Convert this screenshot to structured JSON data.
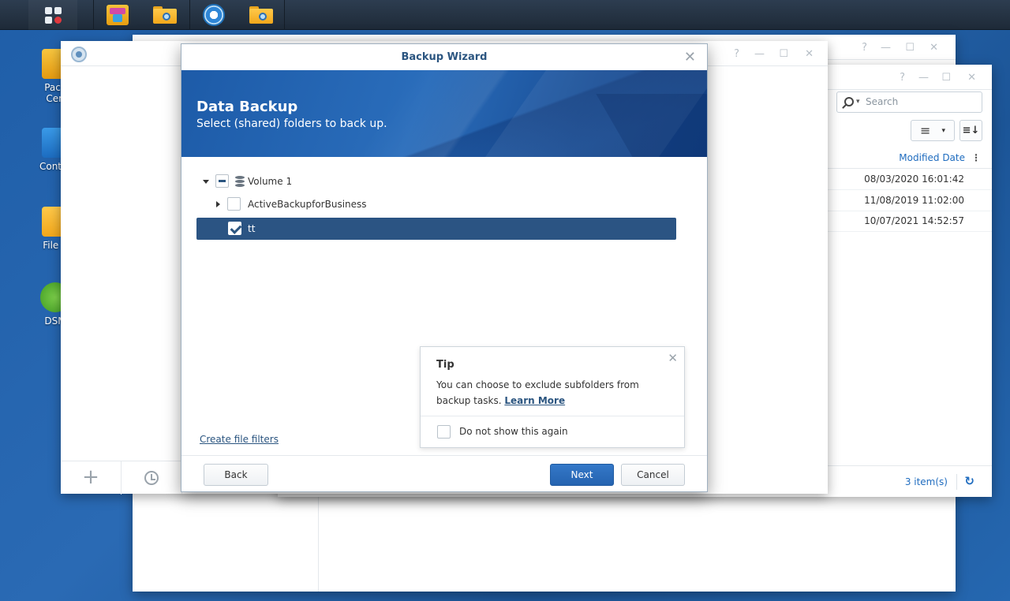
{
  "desktop": {
    "icons": [
      {
        "label": "Pack Cen",
        "line1": "Pack",
        "line2": "Cen"
      },
      {
        "label": "Contro",
        "line1": "Contro",
        "line2": ""
      },
      {
        "label": "File S",
        "line1": "File S",
        "line2": ""
      },
      {
        "label": "DSM",
        "line1": "DSM",
        "line2": ""
      }
    ]
  },
  "file_station": {
    "search_placeholder": "Search",
    "column_header": "Modified Date",
    "rows": [
      {
        "modified": "08/03/2020 16:01:42"
      },
      {
        "modified": "11/08/2019 11:02:00"
      },
      {
        "modified": "10/07/2021 14:52:57"
      }
    ],
    "item_count": "3 item(s)"
  },
  "wizard": {
    "title": "Backup Wizard",
    "heading": "Data Backup",
    "subheading": "Select (shared) folders to back up.",
    "tree": {
      "volume": "Volume 1",
      "folders": [
        {
          "name": "ActiveBackupforBusiness",
          "checked": false,
          "selected": false
        },
        {
          "name": "tt",
          "checked": true,
          "selected": true
        }
      ]
    },
    "create_filters_link": "Create file filters",
    "tip": {
      "title": "Tip",
      "body": "You can choose to exclude subfolders from backup tasks.",
      "learn_more": "Learn More",
      "dont_show": "Do not show this again"
    },
    "buttons": {
      "back": "Back",
      "next": "Next",
      "cancel": "Cancel"
    }
  }
}
